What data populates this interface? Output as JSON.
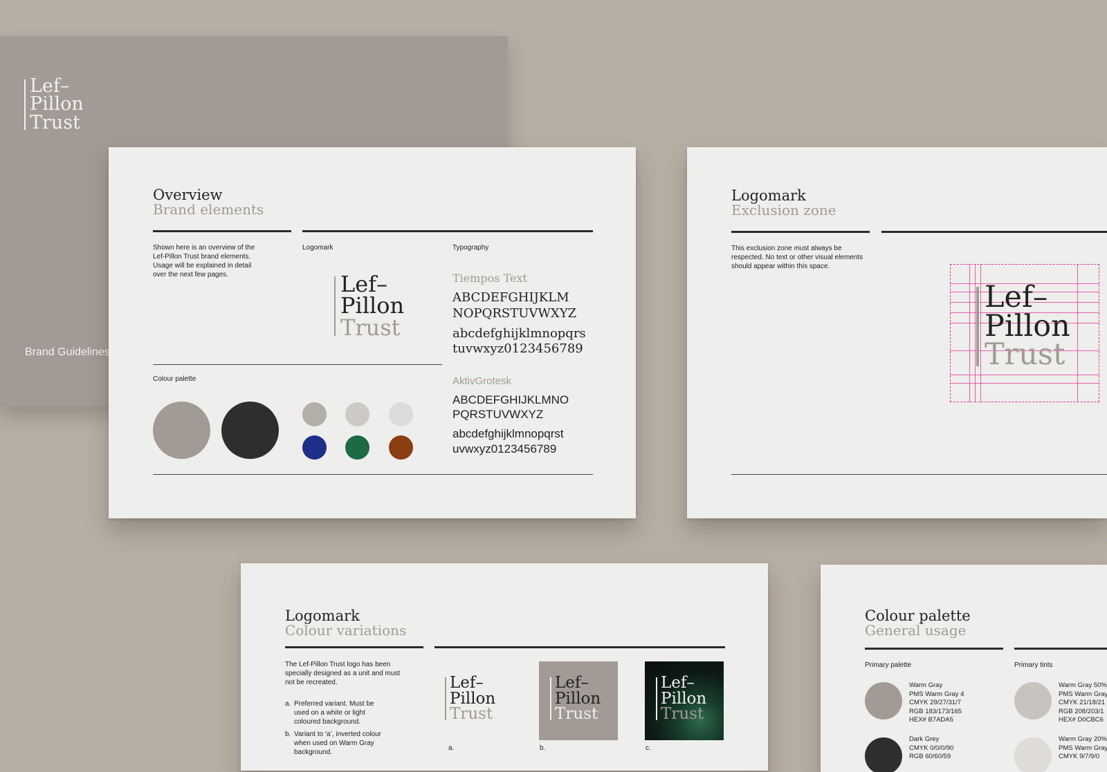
{
  "brand": {
    "logo_lines": [
      "Lef–",
      "Pillon",
      "Trust"
    ],
    "accent": "#a29a94",
    "ink": "#222222",
    "paper": "#eeeeec"
  },
  "cover": {
    "footer": "Brand Guidelines"
  },
  "overview": {
    "title": "Overview",
    "subtitle": "Brand elements",
    "intro": "Shown here is an overview of the Lef-Pillon Trust brand elements. Usage will be explained in detail over the next few pages.",
    "logomark_label": "Logomark",
    "typography_label": "Typography",
    "palette_label": "Colour palette",
    "serif_font_name": "Tiempos Text",
    "serif_upper_1": "ABCDEFGHIJKLM",
    "serif_upper_2": "NOPQRSTUVWXYZ",
    "serif_lower_1": "abcdefghijklmnopqrs",
    "serif_lower_2": "tuvwxyz0123456789",
    "sans_font_name": "AktivGrotesk",
    "sans_upper_1": "ABCDEFGHIJKLMNO",
    "sans_upper_2": "PQRSTUVWXYZ",
    "sans_lower_1": "abcdefghijklmnopqrst",
    "sans_lower_2": "uvwxyz0123456789",
    "palette_colors": [
      "#a29a94",
      "#2e2e2e",
      "#b4aea8",
      "#cdc9c5",
      "#dddbd9",
      "#1e2f8a",
      "#1c6b44",
      "#8a3e12"
    ]
  },
  "exclusion": {
    "title": "Logomark",
    "subtitle": "Exclusion zone",
    "intro": "This exclusion zone must always be respected. No text or other visual elements should appear within this space.",
    "guide_color": "#e0309a"
  },
  "variations": {
    "title": "Logomark",
    "subtitle": "Colour variations",
    "intro": "The Lef-Pillon Trust logo has been specially designed as a unit and must not be recreated.",
    "note_a_marker": "a.",
    "note_a": "Preferred variant. Must be used on a white or light coloured background.",
    "note_b_marker": "b.",
    "note_b": "Variant to ‘a’, inverted colour when used on Warm Gray background.",
    "caption_a": "a.",
    "caption_b": "b.",
    "caption_c": "c."
  },
  "palette": {
    "title": "Colour palette",
    "subtitle": "General usage",
    "primary_label": "Primary palette",
    "tints_label": "Primary tints",
    "warm_gray": {
      "name": "Warm Gray",
      "pms": "PMS Warm Gray 4",
      "cmyk": "CMYK 29/27/31/7",
      "rgb": "RGB 183/173/165",
      "hex": "HEX# B7ADA5",
      "color": "#a29a94"
    },
    "dark_gray": {
      "name": "Dark Grey",
      "cmyk": "CMYK 0/0/0/90",
      "rgb": "RGB 60/60/59",
      "color": "#2e2e2e"
    },
    "tint_50": {
      "name": "Warm Gray 50%",
      "pms": "PMS Warm Gray",
      "cmyk": "CMYK 21/18/21",
      "rgb": "RGB 208/203/1",
      "hex": "HEX# D0CBC6",
      "color": "#c8c3be"
    },
    "tint_20": {
      "name": "Warm Gray 20%",
      "pms": "PMS Warm Gray",
      "cmyk": "CMYK 9/7/9/0",
      "color": "#dedbd8"
    }
  }
}
